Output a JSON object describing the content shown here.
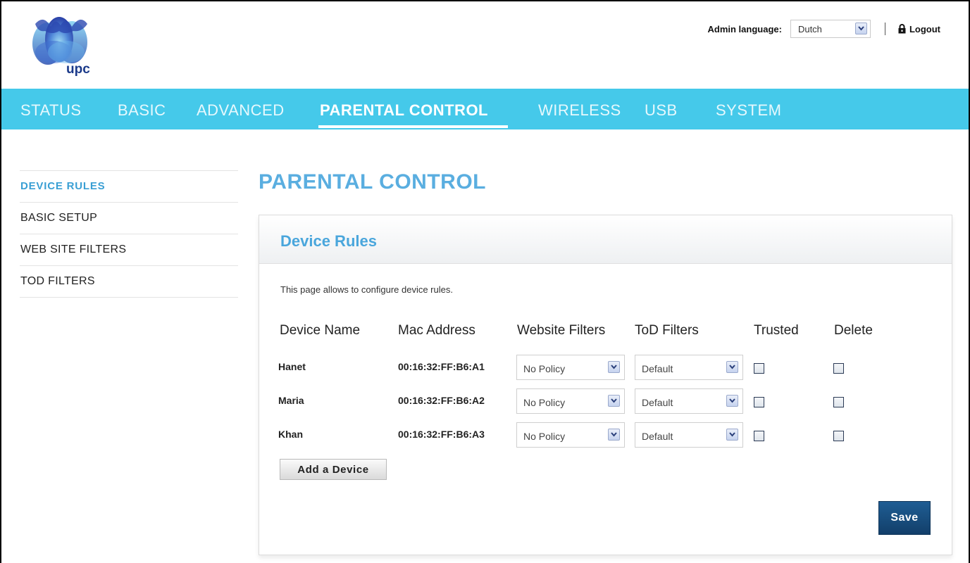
{
  "header": {
    "brand": "upc",
    "admin_language_label": "Admin language:",
    "admin_language_value": "Dutch",
    "logout_label": "Logout"
  },
  "nav": {
    "items": [
      {
        "label": "STATUS"
      },
      {
        "label": "BASIC"
      },
      {
        "label": "ADVANCED"
      },
      {
        "label": "PARENTAL CONTROL"
      },
      {
        "label": "WIRELESS"
      },
      {
        "label": "USB"
      },
      {
        "label": "SYSTEM"
      }
    ],
    "active": "PARENTAL CONTROL"
  },
  "sidebar": {
    "items": [
      {
        "label": "DEVICE RULES"
      },
      {
        "label": "BASIC SETUP"
      },
      {
        "label": "WEB SITE FILTERS"
      },
      {
        "label": "TOD FILTERS"
      }
    ],
    "active": "DEVICE RULES"
  },
  "main": {
    "page_title": "PARENTAL CONTROL",
    "panel_title": "Device Rules",
    "description": "This page allows to configure device rules.",
    "columns": [
      "Device Name",
      "Mac Address",
      "Website Filters",
      "ToD Filters",
      "Trusted",
      "Delete"
    ],
    "rows": [
      {
        "name": "Hanet",
        "mac": "00:16:32:FF:B6:A1",
        "website_filter": "No Policy",
        "tod_filter": "Default",
        "trusted": false,
        "delete": false
      },
      {
        "name": "Maria",
        "mac": "00:16:32:FF:B6:A2",
        "website_filter": "No Policy",
        "tod_filter": "Default",
        "trusted": false,
        "delete": false
      },
      {
        "name": "Khan",
        "mac": "00:16:32:FF:B6:A3",
        "website_filter": "No Policy",
        "tod_filter": "Default",
        "trusted": false,
        "delete": false
      }
    ],
    "add_device_label": "Add a Device",
    "save_label": "Save"
  },
  "colors": {
    "nav_bg": "#45c9ea",
    "title_blue": "#5aaee0",
    "save_button": "#1a4f80"
  }
}
